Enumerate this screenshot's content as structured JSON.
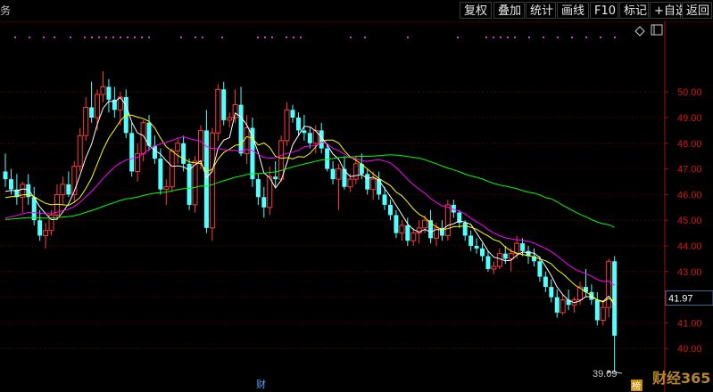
{
  "toolbar": {
    "corner_text": "务",
    "buttons": [
      {
        "label": "复权",
        "name": "fuquan-button"
      },
      {
        "label": "叠加",
        "name": "overlay-button"
      },
      {
        "label": "统计",
        "name": "stats-button"
      },
      {
        "label": "画线",
        "name": "draw-line-button"
      },
      {
        "label": "F10",
        "name": "f10-button"
      },
      {
        "label": "标记",
        "name": "mark-button"
      },
      {
        "label": "+自选",
        "name": "add-watchlist-button"
      },
      {
        "label": "返回",
        "name": "back-button"
      }
    ]
  },
  "chart_data": {
    "type": "candlestick",
    "ylim": [
      39.0,
      51.5
    ],
    "y_ticks": [
      "40.00",
      "41.00",
      "42.00",
      "43.00",
      "44.00",
      "45.00",
      "46.00",
      "47.00",
      "48.00",
      "49.00",
      "50.00"
    ],
    "current_price_label": "41.97",
    "min_price_label": "39.09",
    "marker_caption": "财",
    "corner_badge": "榜",
    "watermark": "财经365",
    "colors": {
      "up": "#ff3a3a",
      "down": "#54ffff",
      "ma5": "#ffffff",
      "ma10": "#ffff00",
      "ma20": "#ff00ff",
      "ma60": "#00ff00",
      "grid": "#5a0000",
      "axis": "#a01010"
    },
    "candles": [
      [
        46.9,
        47.6,
        46.3,
        46.6
      ],
      [
        46.6,
        47.0,
        46.0,
        46.2
      ],
      [
        46.2,
        46.8,
        45.6,
        45.9
      ],
      [
        45.9,
        46.5,
        45.3,
        46.4
      ],
      [
        46.4,
        46.8,
        45.6,
        45.9
      ],
      [
        45.9,
        46.3,
        44.8,
        45.0
      ],
      [
        45.0,
        45.4,
        44.2,
        44.4
      ],
      [
        44.4,
        44.9,
        43.9,
        44.6
      ],
      [
        44.6,
        45.4,
        44.4,
        45.2
      ],
      [
        45.2,
        46.4,
        45.0,
        46.0
      ],
      [
        46.0,
        46.7,
        45.6,
        46.4
      ],
      [
        46.4,
        46.9,
        45.9,
        46.0
      ],
      [
        46.0,
        47.3,
        45.7,
        47.1
      ],
      [
        47.1,
        48.6,
        46.9,
        48.3
      ],
      [
        48.3,
        49.8,
        48.1,
        49.4
      ],
      [
        49.4,
        50.4,
        48.8,
        49.0
      ],
      [
        49.0,
        50.1,
        48.5,
        49.9
      ],
      [
        49.9,
        50.8,
        49.6,
        50.2
      ],
      [
        50.2,
        50.5,
        49.2,
        49.7
      ],
      [
        49.7,
        50.2,
        49.0,
        49.3
      ],
      [
        49.3,
        50.0,
        48.7,
        49.8
      ],
      [
        49.8,
        50.1,
        48.2,
        48.4
      ],
      [
        48.4,
        48.8,
        46.7,
        46.9
      ],
      [
        46.9,
        48.0,
        46.5,
        47.6
      ],
      [
        47.6,
        48.9,
        47.3,
        48.8
      ],
      [
        48.8,
        49.1,
        47.7,
        47.9
      ],
      [
        47.9,
        48.3,
        47.2,
        47.4
      ],
      [
        47.4,
        47.8,
        46.0,
        46.2
      ],
      [
        46.2,
        46.6,
        45.6,
        46.3
      ],
      [
        46.3,
        47.8,
        46.1,
        47.7
      ],
      [
        47.7,
        48.2,
        47.2,
        48.0
      ],
      [
        48.0,
        48.3,
        46.9,
        47.2
      ],
      [
        47.2,
        47.4,
        45.4,
        45.6
      ],
      [
        45.6,
        47.5,
        45.3,
        47.3
      ],
      [
        47.3,
        48.7,
        47.0,
        48.5
      ],
      [
        48.5,
        49.3,
        44.5,
        44.7
      ],
      [
        44.7,
        48.6,
        44.2,
        48.4
      ],
      [
        48.4,
        50.3,
        48.1,
        50.1
      ],
      [
        50.1,
        50.4,
        48.7,
        48.9
      ],
      [
        48.9,
        49.2,
        48.6,
        49.0
      ],
      [
        49.0,
        50.1,
        48.8,
        49.5
      ],
      [
        49.5,
        50.2,
        47.5,
        47.6
      ],
      [
        47.6,
        49.1,
        47.2,
        48.6
      ],
      [
        48.6,
        49.0,
        46.3,
        46.6
      ],
      [
        46.6,
        46.8,
        45.6,
        45.9
      ],
      [
        45.9,
        46.3,
        45.1,
        45.5
      ],
      [
        45.5,
        47.1,
        45.2,
        46.7
      ],
      [
        46.7,
        47.3,
        46.3,
        46.6
      ],
      [
        46.6,
        48.3,
        46.5,
        48.1
      ],
      [
        48.1,
        49.6,
        47.9,
        49.3
      ],
      [
        49.3,
        49.5,
        48.8,
        49.0
      ],
      [
        49.0,
        49.2,
        48.3,
        48.5
      ],
      [
        48.5,
        49.1,
        48.1,
        48.4
      ],
      [
        48.4,
        48.6,
        47.8,
        48.0
      ],
      [
        48.0,
        48.7,
        47.6,
        48.5
      ],
      [
        48.5,
        48.8,
        47.6,
        47.8
      ],
      [
        47.8,
        48.0,
        46.9,
        47.0
      ],
      [
        47.0,
        47.3,
        46.4,
        46.6
      ],
      [
        46.6,
        47.2,
        45.4,
        47.0
      ],
      [
        47.0,
        47.5,
        46.2,
        46.3
      ],
      [
        46.3,
        46.8,
        46.1,
        46.6
      ],
      [
        46.6,
        47.5,
        46.4,
        47.2
      ],
      [
        47.2,
        47.6,
        46.6,
        46.8
      ],
      [
        46.8,
        47.0,
        46.0,
        46.2
      ],
      [
        46.2,
        46.9,
        45.8,
        46.6
      ],
      [
        46.6,
        46.9,
        45.8,
        46.0
      ],
      [
        46.0,
        46.3,
        45.4,
        45.6
      ],
      [
        45.6,
        45.8,
        45.0,
        45.2
      ],
      [
        45.2,
        45.4,
        44.3,
        44.5
      ],
      [
        44.5,
        45.0,
        44.2,
        44.8
      ],
      [
        44.8,
        45.1,
        44.0,
        44.2
      ],
      [
        44.2,
        44.7,
        44.0,
        44.5
      ],
      [
        44.5,
        45.0,
        44.1,
        44.7
      ],
      [
        44.7,
        45.2,
        44.5,
        45.0
      ],
      [
        45.0,
        45.4,
        44.1,
        44.3
      ],
      [
        44.3,
        44.9,
        44.0,
        44.7
      ],
      [
        44.7,
        45.0,
        44.2,
        44.4
      ],
      [
        44.4,
        45.8,
        44.2,
        45.6
      ],
      [
        45.6,
        45.8,
        45.1,
        45.3
      ],
      [
        45.3,
        45.4,
        44.7,
        44.9
      ],
      [
        44.9,
        45.0,
        44.2,
        44.4
      ],
      [
        44.4,
        44.6,
        43.8,
        44.0
      ],
      [
        44.0,
        44.3,
        43.7,
        43.9
      ],
      [
        43.9,
        44.1,
        43.4,
        43.6
      ],
      [
        43.6,
        43.8,
        43.0,
        43.1
      ],
      [
        43.1,
        43.4,
        42.9,
        43.2
      ],
      [
        43.2,
        43.9,
        43.1,
        43.7
      ],
      [
        43.7,
        44.0,
        43.3,
        43.5
      ],
      [
        43.5,
        43.9,
        43.0,
        43.7
      ],
      [
        43.7,
        44.4,
        43.5,
        44.1
      ],
      [
        44.1,
        44.3,
        43.6,
        43.8
      ],
      [
        43.8,
        44.0,
        43.3,
        43.6
      ],
      [
        43.6,
        43.9,
        43.2,
        43.4
      ],
      [
        43.4,
        43.6,
        42.6,
        42.8
      ],
      [
        42.8,
        43.0,
        42.2,
        42.4
      ],
      [
        42.4,
        42.7,
        41.8,
        42.0
      ],
      [
        42.0,
        42.3,
        41.2,
        41.4
      ],
      [
        41.4,
        42.1,
        41.3,
        41.9
      ],
      [
        41.9,
        42.3,
        41.5,
        41.7
      ],
      [
        41.7,
        42.0,
        41.4,
        41.9
      ],
      [
        41.9,
        42.6,
        41.7,
        42.4
      ],
      [
        42.4,
        43.1,
        42.0,
        42.2
      ],
      [
        42.2,
        42.5,
        41.7,
        41.9
      ],
      [
        41.9,
        42.2,
        40.9,
        41.1
      ],
      [
        41.1,
        41.8,
        40.9,
        41.6
      ],
      [
        41.6,
        43.5,
        41.2,
        43.4
      ],
      [
        43.4,
        43.6,
        39.09,
        40.5
      ]
    ]
  }
}
